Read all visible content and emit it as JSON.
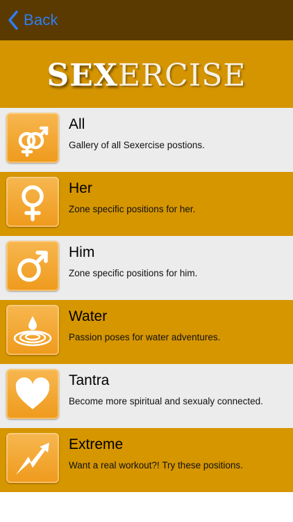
{
  "nav": {
    "back_label": "Back"
  },
  "banner": {
    "logo_part1": "SEX",
    "logo_part2": "ERCISE"
  },
  "categories": [
    {
      "title": "All",
      "subtitle": "Gallery of all Sexercise postions.",
      "icon": "gender-symbols-icon"
    },
    {
      "title": "Her",
      "subtitle": "Zone specific positions for her.",
      "icon": "female-symbol-icon"
    },
    {
      "title": "Him",
      "subtitle": "Zone specific positions for him.",
      "icon": "male-symbol-icon"
    },
    {
      "title": "Water",
      "subtitle": "Passion poses for water adventures.",
      "icon": "water-drop-icon"
    },
    {
      "title": "Tantra",
      "subtitle": "Become more spiritual and sexualy connected.",
      "icon": "heart-icon"
    },
    {
      "title": "Extreme",
      "subtitle": "Want a real workout?! Try these positions.",
      "icon": "lightning-icon"
    }
  ],
  "colors": {
    "navbar": "#5a3a00",
    "banner": "#d59500",
    "row_light": "#ececec",
    "row_gold": "#d69600",
    "back_blue": "#2d7ff2",
    "icon_orange": "#ef9a1c"
  }
}
